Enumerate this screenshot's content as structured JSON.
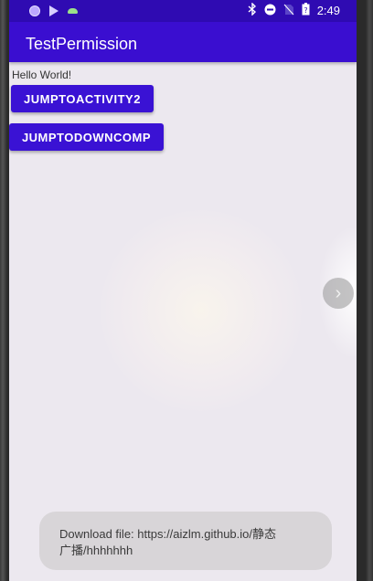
{
  "status_bar": {
    "time": "2:49",
    "left_icons": [
      "notification-dot-icon",
      "play-store-icon",
      "cloud-icon"
    ],
    "right_icons": [
      "bluetooth-icon",
      "do-not-disturb-icon",
      "no-sim-icon",
      "battery-icon"
    ]
  },
  "app_bar": {
    "title": "TestPermission"
  },
  "content": {
    "hello_text": "Hello World!",
    "button_1_label": "JUMPTOACTIVITY2",
    "button_2_label": "JUMPTODOWNCOMP"
  },
  "side_handle": {
    "glyph": "›"
  },
  "toast": {
    "line1": "Download file: https://aizlm.github.io/静态",
    "line2": "广播/hhhhhhh"
  },
  "colors": {
    "status_bar": "#2f0bb2",
    "app_bar": "#3a0ed0",
    "button": "#3a12d4",
    "background": "#ece8ef"
  }
}
